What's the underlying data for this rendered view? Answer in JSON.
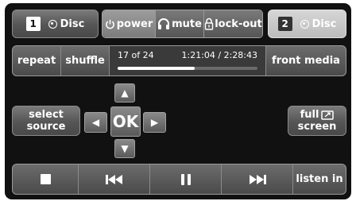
{
  "top": {
    "source1": {
      "number": "1",
      "label": "Disc"
    },
    "power": "power",
    "mute": "mute",
    "lockout": "lock-out",
    "source2": {
      "number": "2",
      "label": "Disc"
    }
  },
  "transport_bar": {
    "repeat": "repeat",
    "shuffle": "shuffle",
    "track_position": "17 of 24",
    "time": "1:21:04 / 2:28:43",
    "progress_fraction": 0.55,
    "front_media": "front media"
  },
  "nav": {
    "select_source_line1": "select",
    "select_source_line2": "source",
    "ok": "OK",
    "full_screen_line1": "full",
    "full_screen_line2": "screen"
  },
  "bottom_bar": {
    "listen_in": "listen in"
  },
  "icons": [
    "disc-icon",
    "power-icon",
    "headphones-icon",
    "lock-icon",
    "stop-icon",
    "previous-icon",
    "pause-icon",
    "next-icon",
    "fullscreen-icon",
    "arrow-up-icon",
    "arrow-down-icon",
    "arrow-left-icon",
    "arrow-right-icon"
  ]
}
